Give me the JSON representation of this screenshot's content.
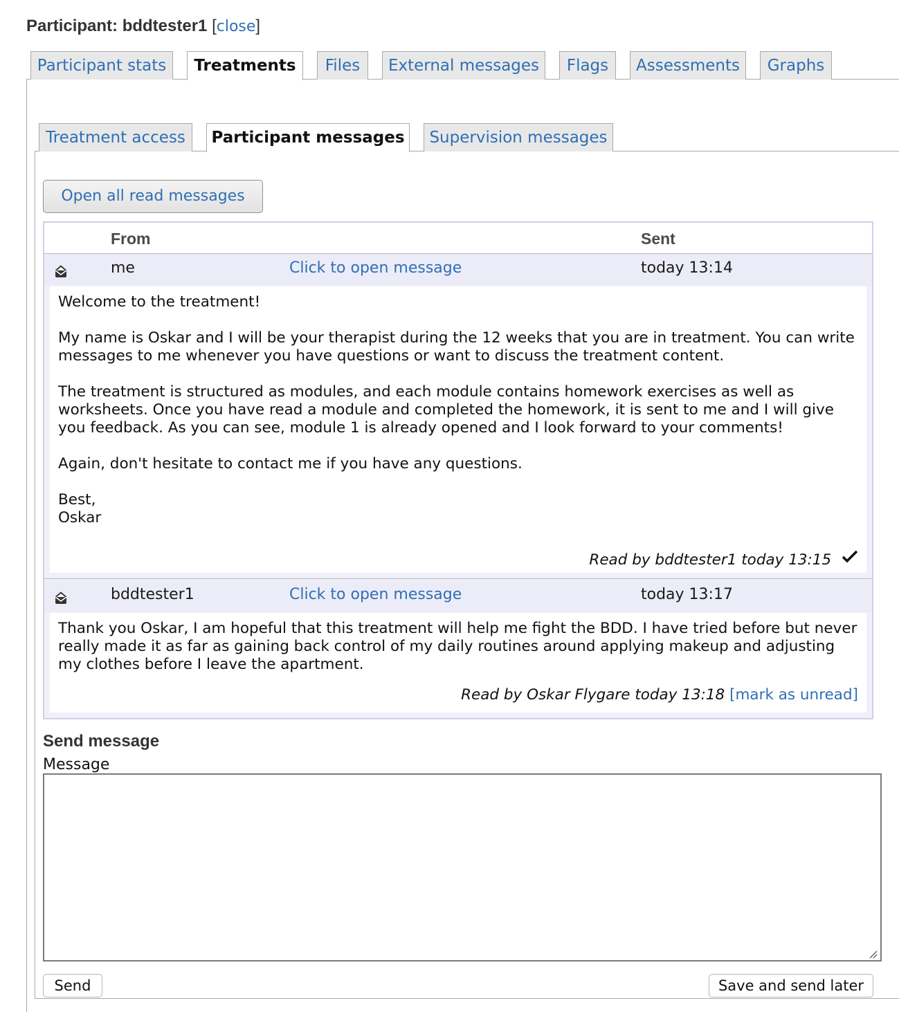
{
  "header": {
    "label": "Participant: bddtester1",
    "bracket_open": "[",
    "close_link": "close",
    "bracket_close": "]"
  },
  "main_tabs": [
    {
      "label": "Participant stats",
      "active": false
    },
    {
      "label": "Treatments",
      "active": true
    },
    {
      "label": "Files",
      "active": false
    },
    {
      "label": "External messages",
      "active": false
    },
    {
      "label": "Flags",
      "active": false
    },
    {
      "label": "Assessments",
      "active": false
    },
    {
      "label": "Graphs",
      "active": false
    }
  ],
  "sub_tabs": [
    {
      "label": "Treatment access",
      "active": false
    },
    {
      "label": "Participant messages",
      "active": true
    },
    {
      "label": "Supervision messages",
      "active": false
    }
  ],
  "open_all_button": "Open all read messages",
  "table": {
    "columns": {
      "from": "From",
      "sent": "Sent"
    },
    "messages": [
      {
        "icon": "open-envelope-icon",
        "from": "me",
        "open_link": "Click to open message",
        "sent": "today 13:14",
        "body": [
          "Welcome to the treatment!",
          "My name is Oskar and I will be your therapist during the 12 weeks that you are in treatment. You can write messages to me whenever you have questions or want to discuss the treatment content.",
          "The treatment is structured as modules, and each module contains homework exercises as well as worksheets. Once you have read a module and completed the homework, it is sent to me and I will give you feedback. As you can see, module 1 is already opened and I look forward to your comments!",
          "Again, don't hesitate to contact me if you have any questions.",
          "Best,",
          "Oskar"
        ],
        "read_text": "Read by bddtester1 today 13:15",
        "read_icon": "checkmark-icon"
      },
      {
        "icon": "open-envelope-icon",
        "from": "bddtester1",
        "open_link": "Click to open message",
        "sent": "today 13:17",
        "body": [
          "Thank you Oskar, I am hopeful that this treatment will help me fight the BDD. I have tried before but never really made it as far as gaining back control of my daily routines around applying makeup and adjusting my clothes before I leave the apartment."
        ],
        "read_text": "Read by Oskar Flygare today 13:18",
        "mark_unread_link": "[mark as unread]"
      }
    ]
  },
  "send_form": {
    "title": "Send message",
    "message_label": "Message",
    "message_value": "",
    "send_button": "Send",
    "save_button": "Save and send later"
  },
  "colors": {
    "link": "#2f6fb4",
    "row_background": "#ececf9",
    "tab_background": "#e8e8e8"
  }
}
